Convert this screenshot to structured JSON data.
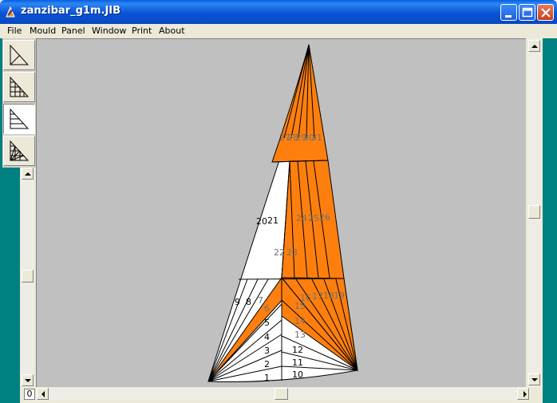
{
  "window": {
    "title": "zanzibar_g1m.JIB",
    "controls": [
      "minimize-icon",
      "maximize-icon",
      "close-icon"
    ]
  },
  "menu": [
    "File",
    "Mould",
    "Panel",
    "Window",
    "Print",
    "About"
  ],
  "tools": [
    {
      "name": "sail-outline-tool",
      "icon": "sail-outline-icon",
      "active": false
    },
    {
      "name": "sail-grid-tool",
      "icon": "sail-grid-icon",
      "active": false
    },
    {
      "name": "sail-horizontal-panels-tool",
      "icon": "sail-horizontal-panels-icon",
      "active": true
    },
    {
      "name": "sail-mesh-tool",
      "icon": "sail-mesh-icon",
      "active": false
    }
  ],
  "scroll_zero_label": "0",
  "colors": {
    "panel_orange": "#ff7f0e",
    "panel_white": "#ffffff",
    "canvas_bg": "#c0c0c0",
    "label_gray": "#707070"
  },
  "panel_labels": {
    "white_lower": [
      "1",
      "2",
      "3",
      "4",
      "5",
      "10",
      "11",
      "12",
      "9",
      "8",
      "20",
      "21"
    ],
    "orange": [
      "7",
      "6",
      "13",
      "14",
      "15",
      "16",
      "17",
      "18",
      "19",
      "22",
      "23",
      "24",
      "25",
      "26",
      "27",
      "28",
      "29",
      "30",
      "31"
    ]
  }
}
